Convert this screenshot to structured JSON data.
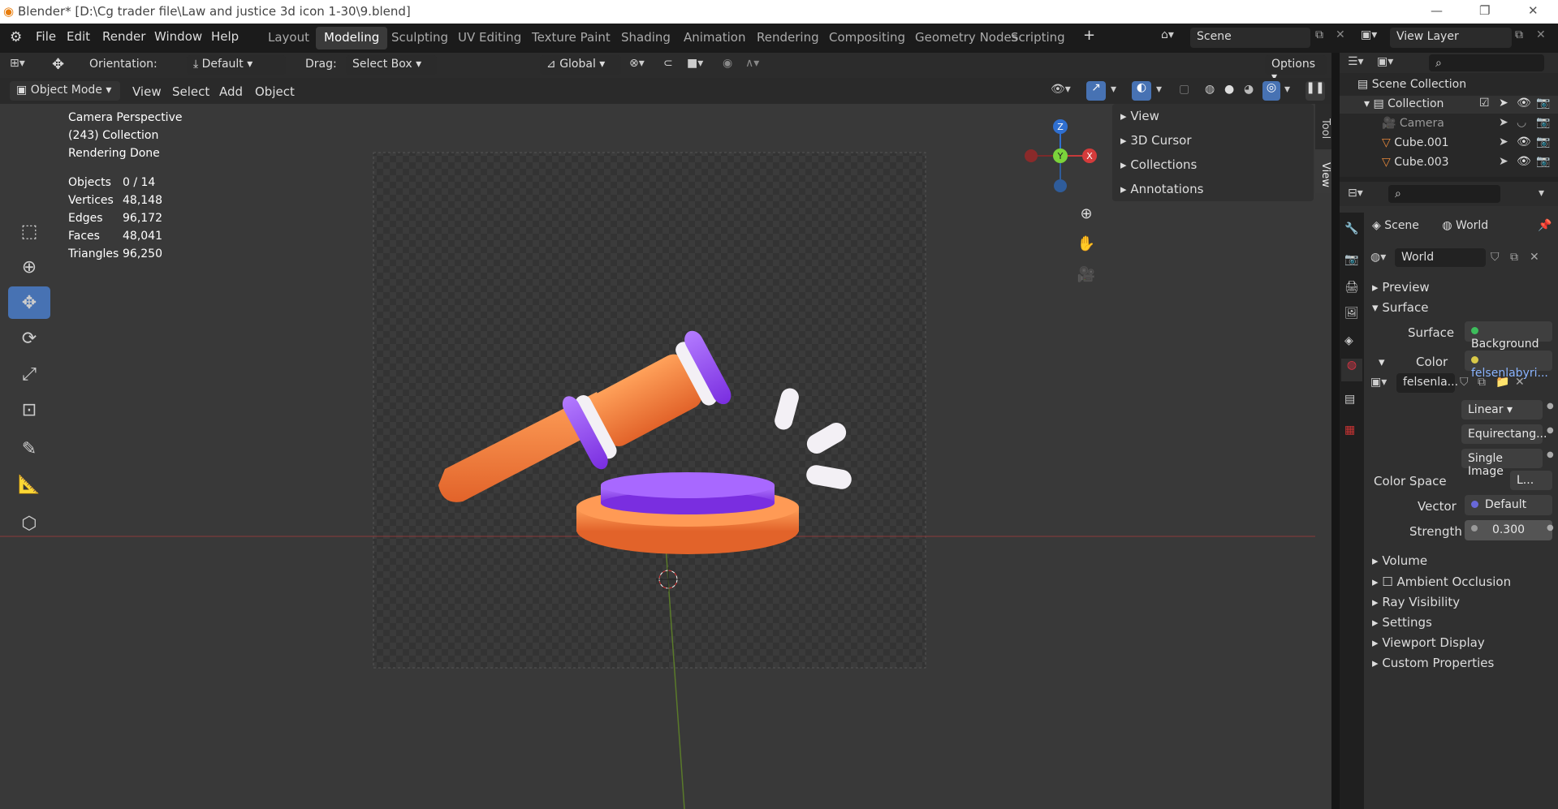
{
  "window": {
    "title": "Blender* [D:\\Cg trader file\\Law and justice 3d icon 1-30\\9.blend]"
  },
  "menus": [
    "File",
    "Edit",
    "Render",
    "Window",
    "Help"
  ],
  "workspaces": [
    "Layout",
    "Modeling",
    "Sculpting",
    "UV Editing",
    "Texture Paint",
    "Shading",
    "Animation",
    "Rendering",
    "Compositing",
    "Geometry Nodes",
    "Scripting"
  ],
  "active_workspace": "Modeling",
  "scene_name": "Scene",
  "view_layer": "View Layer",
  "tool_header": {
    "orientation_label": "Orientation:",
    "orientation_value": "Default",
    "drag_label": "Drag:",
    "drag_value": "Select Box",
    "transform_space": "Global",
    "options": "Options"
  },
  "viewport_header": {
    "mode": "Object Mode",
    "menus": [
      "View",
      "Select",
      "Add",
      "Object"
    ]
  },
  "overlay": {
    "line1": "Camera Perspective",
    "line2": "(243) Collection",
    "line3": "Rendering Done"
  },
  "stats": [
    {
      "label": "Objects",
      "value": "0 / 14"
    },
    {
      "label": "Vertices",
      "value": "48,148"
    },
    {
      "label": "Edges",
      "value": "96,172"
    },
    {
      "label": "Faces",
      "value": "48,041"
    },
    {
      "label": "Triangles",
      "value": "96,250"
    }
  ],
  "n_panel": {
    "items": [
      "View",
      "3D Cursor",
      "Collections",
      "Annotations"
    ],
    "tabs": [
      "Tool",
      "View"
    ]
  },
  "gizmo": {
    "z": "Z",
    "y": "Y",
    "x": "X"
  },
  "outliner": {
    "scene_collection": "Scene Collection",
    "collection": "Collection",
    "items": [
      "Camera",
      "Cube.001",
      "Cube.003"
    ]
  },
  "properties": {
    "breadcrumb_scene": "Scene",
    "breadcrumb_world": "World",
    "world_name": "World",
    "sections": {
      "preview": "Preview",
      "surface": "Surface"
    },
    "surface_label": "Surface",
    "surface_value": "Background",
    "color_label": "Color",
    "color_value": "felsenlabyri...",
    "image_name": "felsenla...",
    "interpolation": "Linear",
    "projection": "Equirectang...",
    "source": "Single Image",
    "color_space_label": "Color Space",
    "color_space_value": "L...",
    "vector_label": "Vector",
    "vector_value": "Default",
    "strength_label": "Strength",
    "strength_value": "0.300",
    "collapsed": [
      "Volume",
      "Ambient Occlusion",
      "Ray Visibility",
      "Settings",
      "Viewport Display",
      "Custom Properties"
    ]
  },
  "colors": {
    "accent": "#4772b3",
    "hammer_orange": "#f07a3a",
    "hammer_purple": "#8a38e6"
  }
}
